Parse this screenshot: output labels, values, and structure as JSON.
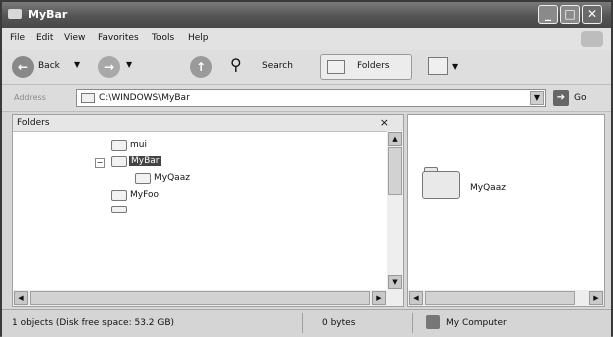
{
  "window": {
    "title": "MyBar"
  },
  "menubar": {
    "items": [
      "File",
      "Edit",
      "View",
      "Favorites",
      "Tools",
      "Help"
    ]
  },
  "toolbar": {
    "back_label": "Back",
    "search_label": "Search",
    "folders_label": "Folders"
  },
  "address": {
    "label": "Address",
    "value": "C:\\WINDOWS\\MyBar",
    "go_label": "Go"
  },
  "folders_pane": {
    "title": "Folders",
    "close_glyph": "×",
    "tree": [
      {
        "label": "mui"
      },
      {
        "label": "MyBar",
        "selected": true,
        "expanded": true
      },
      {
        "label": "MyQaaz",
        "child": true
      },
      {
        "label": "MyFoo"
      }
    ]
  },
  "content": {
    "items": [
      {
        "name": "MyQaaz",
        "icon": "folder-icon"
      }
    ]
  },
  "statusbar": {
    "objects": "1 objects (Disk free space: 53.2 GB)",
    "size": "0 bytes",
    "location": "My Computer"
  },
  "colors": {
    "selection": "#444444",
    "title": "#555555"
  }
}
